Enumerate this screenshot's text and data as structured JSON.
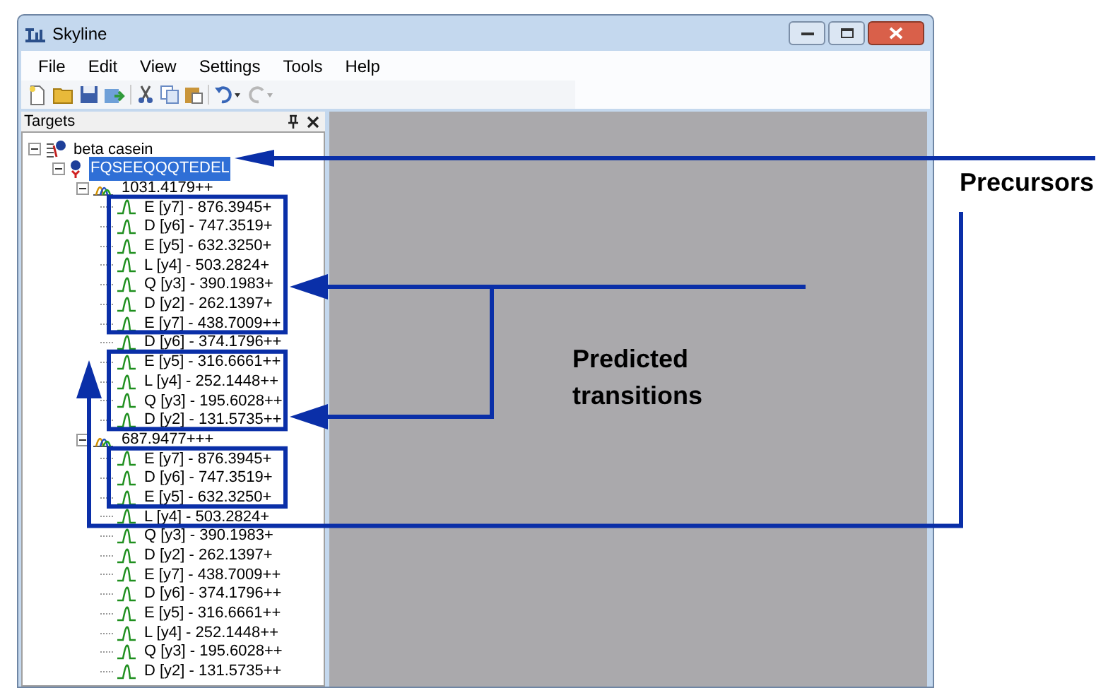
{
  "window": {
    "title": "Skyline"
  },
  "menu": [
    "File",
    "Edit",
    "View",
    "Settings",
    "Tools",
    "Help"
  ],
  "panel": {
    "title": "Targets"
  },
  "tree": [
    {
      "label": "beta casein",
      "kind": "protein",
      "expanded": true,
      "selected": false,
      "children": [
        {
          "label": "FQSEEQQQTEDEL",
          "kind": "peptide",
          "expanded": true,
          "selected": true,
          "children": [
            {
              "label": "1031.4179++",
              "kind": "precursor",
              "expanded": true,
              "selected": false,
              "children": [
                {
                  "label": "E [y7] - 876.3945+",
                  "kind": "transition",
                  "selected": false
                },
                {
                  "label": "D [y6] - 747.3519+",
                  "kind": "transition",
                  "selected": false
                },
                {
                  "label": "E [y5] - 632.3250+",
                  "kind": "transition",
                  "selected": false
                },
                {
                  "label": "L [y4] - 503.2824+",
                  "kind": "transition",
                  "selected": false
                },
                {
                  "label": "Q [y3] - 390.1983+",
                  "kind": "transition",
                  "selected": false
                },
                {
                  "label": "D [y2] - 262.1397+",
                  "kind": "transition",
                  "selected": false
                },
                {
                  "label": "E [y7] - 438.7009++",
                  "kind": "transition",
                  "selected": false
                },
                {
                  "label": "D [y6] - 374.1796++",
                  "kind": "transition",
                  "selected": false
                },
                {
                  "label": "E [y5] - 316.6661++",
                  "kind": "transition",
                  "selected": false
                },
                {
                  "label": "L [y4] - 252.1448++",
                  "kind": "transition",
                  "selected": false
                },
                {
                  "label": "Q [y3] - 195.6028++",
                  "kind": "transition",
                  "selected": false
                },
                {
                  "label": "D [y2] - 131.5735++",
                  "kind": "transition",
                  "selected": false
                }
              ]
            },
            {
              "label": "687.9477+++",
              "kind": "precursor",
              "expanded": true,
              "selected": false,
              "children": [
                {
                  "label": "E [y7] - 876.3945+",
                  "kind": "transition",
                  "selected": false
                },
                {
                  "label": "D [y6] - 747.3519+",
                  "kind": "transition",
                  "selected": false
                },
                {
                  "label": "E [y5] - 632.3250+",
                  "kind": "transition",
                  "selected": false
                },
                {
                  "label": "L [y4] - 503.2824+",
                  "kind": "transition",
                  "selected": false
                },
                {
                  "label": "Q [y3] - 390.1983+",
                  "kind": "transition",
                  "selected": false
                },
                {
                  "label": "D [y2] - 262.1397+",
                  "kind": "transition",
                  "selected": false
                },
                {
                  "label": "E [y7] - 438.7009++",
                  "kind": "transition",
                  "selected": false
                },
                {
                  "label": "D [y6] - 374.1796++",
                  "kind": "transition",
                  "selected": false
                },
                {
                  "label": "E [y5] - 316.6661++",
                  "kind": "transition",
                  "selected": false
                },
                {
                  "label": "L [y4] - 252.1448++",
                  "kind": "transition",
                  "selected": false
                },
                {
                  "label": "Q [y3] - 195.6028++",
                  "kind": "transition",
                  "selected": false
                },
                {
                  "label": "D [y2] - 131.5735++",
                  "kind": "transition",
                  "selected": false
                }
              ]
            }
          ]
        }
      ]
    }
  ],
  "annotations": [
    {
      "text": "Precursors",
      "kind": "precursors"
    },
    {
      "text": "Predicted transitions",
      "kind": "transitions"
    }
  ]
}
